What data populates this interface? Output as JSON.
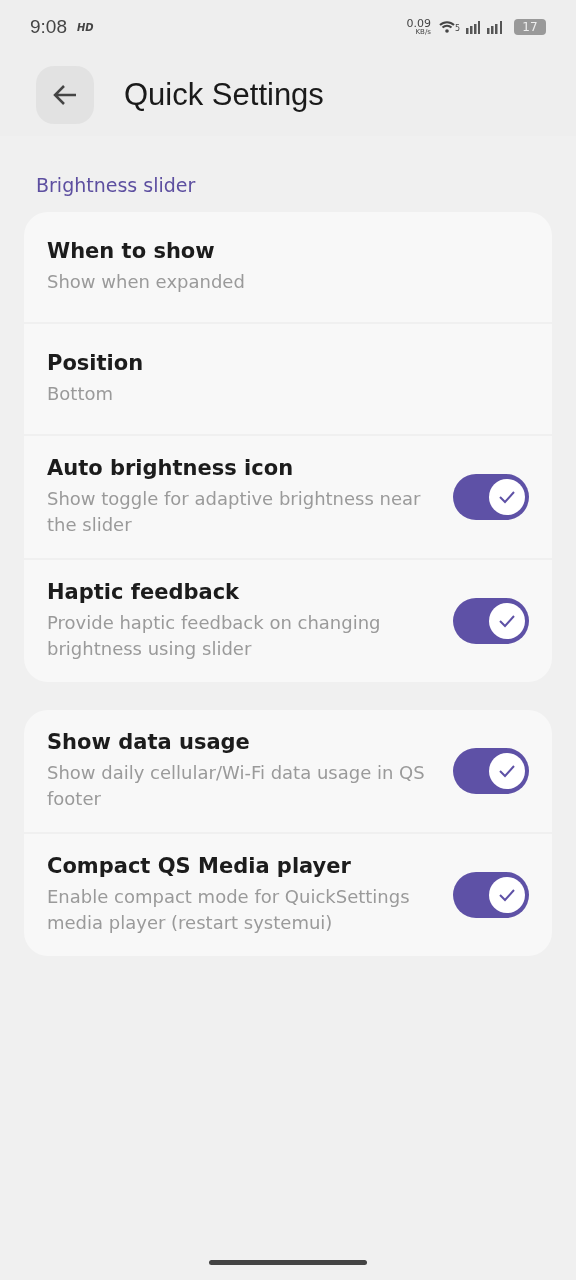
{
  "status_bar": {
    "time": "9:08",
    "hd": "HD",
    "speed": "0.09",
    "speed_unit": "KB/s",
    "wifi_badge": "5",
    "battery": "17"
  },
  "app_bar": {
    "title": "Quick Settings"
  },
  "groups": [
    {
      "header": "Brightness slider",
      "items": [
        {
          "kind": "nav",
          "title": "When to show",
          "subtitle": "Show when expanded"
        },
        {
          "kind": "nav",
          "title": "Position",
          "subtitle": "Bottom"
        },
        {
          "kind": "switch",
          "title": "Auto brightness icon",
          "subtitle": "Show toggle for adaptive brightness near the slider",
          "on": true
        },
        {
          "kind": "switch",
          "title": "Haptic feedback",
          "subtitle": "Provide haptic feedback on changing brightness using slider",
          "on": true
        }
      ]
    },
    {
      "items": [
        {
          "kind": "switch",
          "title": "Show data usage",
          "subtitle": "Show daily cellular/Wi-Fi data usage in QS footer",
          "on": true
        },
        {
          "kind": "switch",
          "title": "Compact QS Media player",
          "subtitle": "Enable compact mode for QuickSettings media player (restart systemui)",
          "on": true
        }
      ]
    }
  ]
}
